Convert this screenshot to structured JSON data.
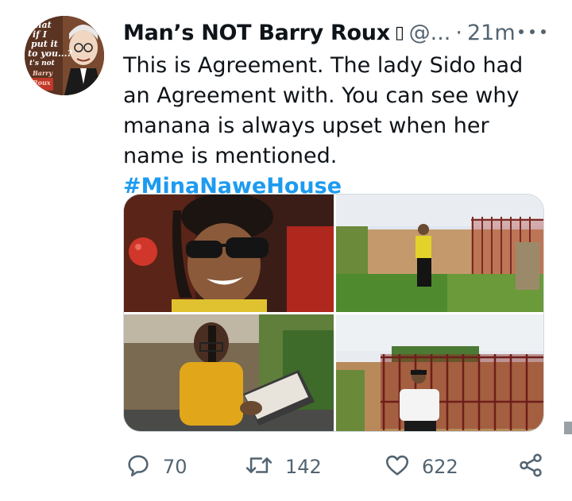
{
  "tweet": {
    "author": {
      "display_name": "Man’s NOT Barry Roux",
      "name_suffix": "▯",
      "handle": "@...",
      "avatar_text_lines": [
        "what",
        "if I",
        "put it",
        "to you...?",
        "t's not",
        "Barry",
        "Roux"
      ]
    },
    "separator": "·",
    "timestamp": "21m",
    "text": "This is Agreement. The lady Sido had an Agreement with. You can see why manana is always upset when her name is mentioned.",
    "hashtag": "#MinaNaweHouse",
    "media": [
      {
        "name": "photo-woman-sunglasses-closeup"
      },
      {
        "name": "photo-woman-garden-yellow-top"
      },
      {
        "name": "photo-woman-reading-book"
      },
      {
        "name": "photo-woman-gate-white-top"
      }
    ],
    "stats": {
      "replies": "70",
      "retweets": "142",
      "likes": "622"
    }
  },
  "icons": {
    "reply": "comment-bubble-icon",
    "retweet": "retweet-arrows-icon",
    "like": "heart-icon",
    "share": "share-nodes-icon",
    "more": "more-dots-icon"
  },
  "colors": {
    "hashtag": "#1d9bf0",
    "secondary_text": "#536471",
    "primary_text": "#0f1419"
  }
}
